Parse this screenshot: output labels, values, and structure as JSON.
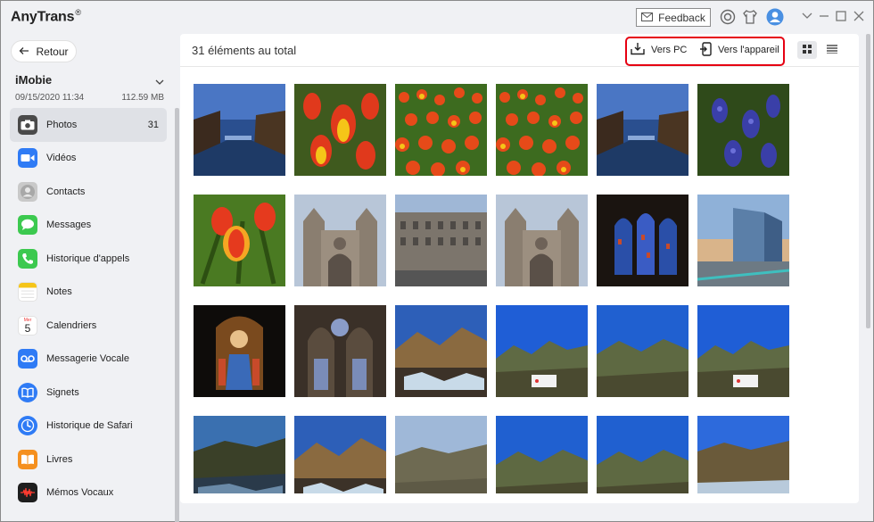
{
  "app": {
    "title": "AnyTrans",
    "reg_mark": "®"
  },
  "titlebar": {
    "feedback_label": "Feedback"
  },
  "sidebar": {
    "back_label": "Retour",
    "device_name": "iMobie",
    "device_date": "09/15/2020 11:34",
    "device_size": "112.59 MB",
    "items": [
      {
        "label": "Photos",
        "count": "31",
        "icon": "camera-icon",
        "color": "#4a4a4a"
      },
      {
        "label": "Vidéos",
        "count": "",
        "icon": "video-icon",
        "color": "#2f7bf5"
      },
      {
        "label": "Contacts",
        "count": "",
        "icon": "contacts-icon",
        "color": "#9a9a9a"
      },
      {
        "label": "Messages",
        "count": "",
        "icon": "messages-icon",
        "color": "#3cc94f"
      },
      {
        "label": "Historique d'appels",
        "count": "",
        "icon": "phone-icon",
        "color": "#3cc94f"
      },
      {
        "label": "Notes",
        "count": "",
        "icon": "notes-icon",
        "color": "#f5c518"
      },
      {
        "label": "Calendriers",
        "count": "",
        "icon": "calendar-icon",
        "color": "#ffffff",
        "text": "5",
        "top": "Mer"
      },
      {
        "label": "Messagerie Vocale",
        "count": "",
        "icon": "voicemail-icon",
        "color": "#2f7bf5"
      },
      {
        "label": "Signets",
        "count": "",
        "icon": "bookmarks-icon",
        "color": "#2f7bf5"
      },
      {
        "label": "Historique de Safari",
        "count": "",
        "icon": "safari-icon",
        "color": "#2f7bf5"
      },
      {
        "label": "Livres",
        "count": "",
        "icon": "books-icon",
        "color": "#f5901e"
      },
      {
        "label": "Mémos Vocaux",
        "count": "",
        "icon": "voice-memos-icon",
        "color": "#1e1e1e"
      }
    ]
  },
  "main": {
    "total_label": "31 éléments au total",
    "to_pc_label": "Vers PC",
    "to_device_label": "Vers l'appareil",
    "accent": "#e60012"
  },
  "photos": [
    "canal",
    "tulips-close",
    "tulips-field",
    "tulips-field",
    "canal",
    "hyacinth",
    "tulip-single",
    "cathedral",
    "street",
    "cathedral",
    "stained-glass",
    "skyscraper",
    "stained-portrait",
    "cathedral-interior",
    "river-winter",
    "mountain-sign",
    "mountain",
    "mountain-sign",
    "mountain-dark",
    "river-winter",
    "mountain-plain",
    "mountain",
    "mountain",
    "river-bright"
  ]
}
